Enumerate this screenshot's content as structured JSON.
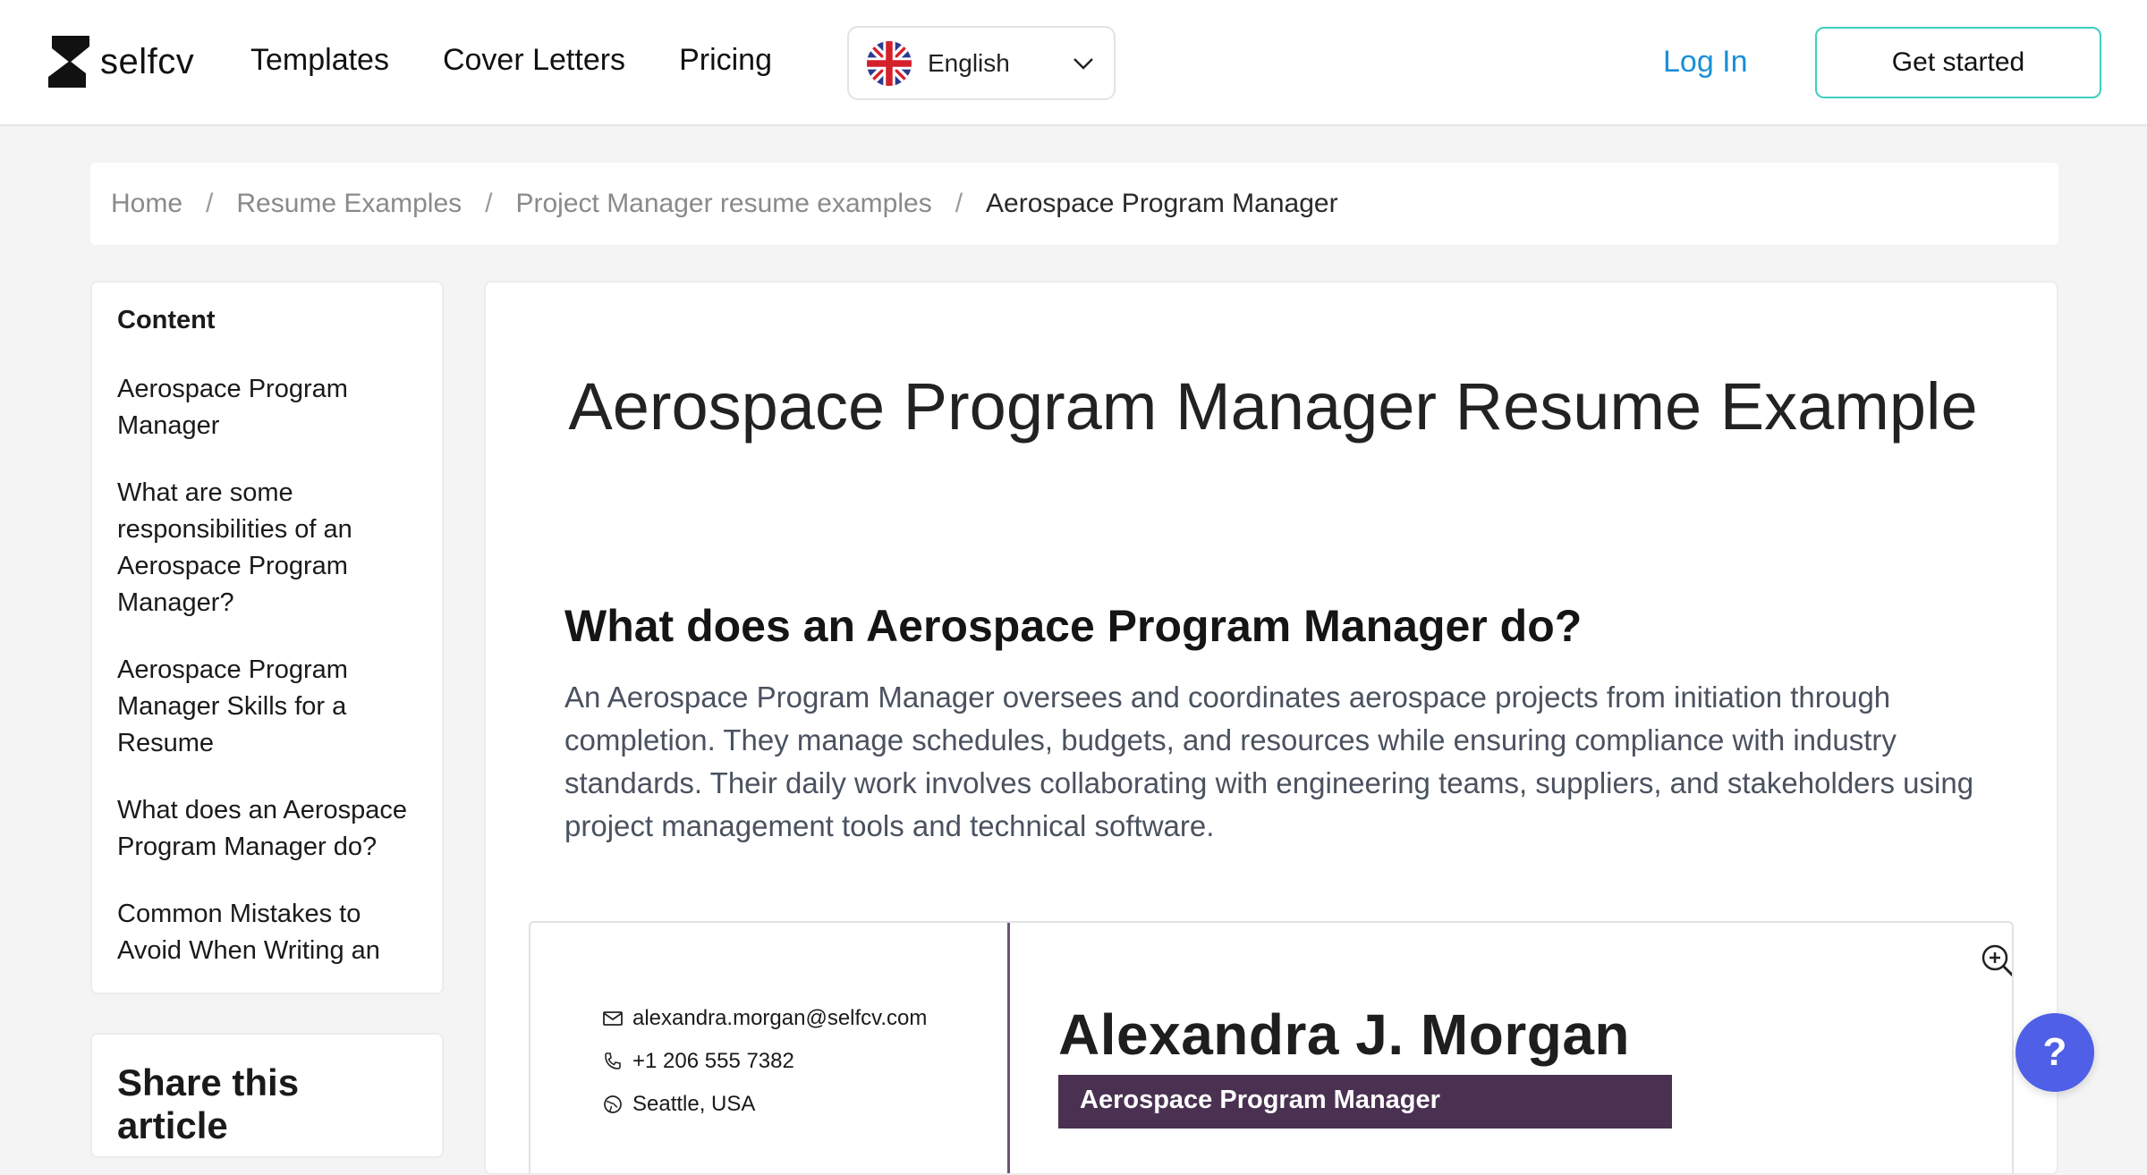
{
  "header": {
    "logo_text": "selfcv",
    "nav": [
      "Templates",
      "Cover Letters",
      "Pricing"
    ],
    "language": "English",
    "login": "Log In",
    "cta": "Get started"
  },
  "breadcrumb": {
    "items": [
      "Home",
      "Resume Examples",
      "Project Manager resume examples"
    ],
    "separator": "/",
    "current": "Aerospace Program Manager"
  },
  "toc": {
    "title": "Content",
    "items": [
      "Aerospace Program Manager",
      "What are some responsibilities of an Aerospace Program Manager?",
      "Aerospace Program Manager Skills for a Resume",
      "What does an Aerospace Program Manager do?",
      "Common Mistakes to Avoid When Writing an"
    ]
  },
  "share": {
    "title": "Share this article"
  },
  "main": {
    "title": "Aerospace Program Manager Resume Example",
    "section_heading": "What does an Aerospace Program Manager do?",
    "section_text": "An Aerospace Program Manager oversees and coordinates aerospace projects from initiation through completion. They manage schedules, budgets, and resources while ensuring compliance with industry standards. Their daily work involves collaborating with engineering teams, suppliers, and stakeholders using project management tools and technical software."
  },
  "resume": {
    "email": "alexandra.morgan@selfcv.com",
    "phone": "+1 206 555 7382",
    "location": "Seattle, USA",
    "name": "Alexandra J. Morgan",
    "role": "Aerospace Program Manager"
  },
  "help": {
    "label": "?"
  },
  "colors": {
    "accent_link": "#1a8fd6",
    "cta_border": "#3ccfc0",
    "resume_role_bg": "#4a3151",
    "help_bg": "#4f5fe6"
  }
}
